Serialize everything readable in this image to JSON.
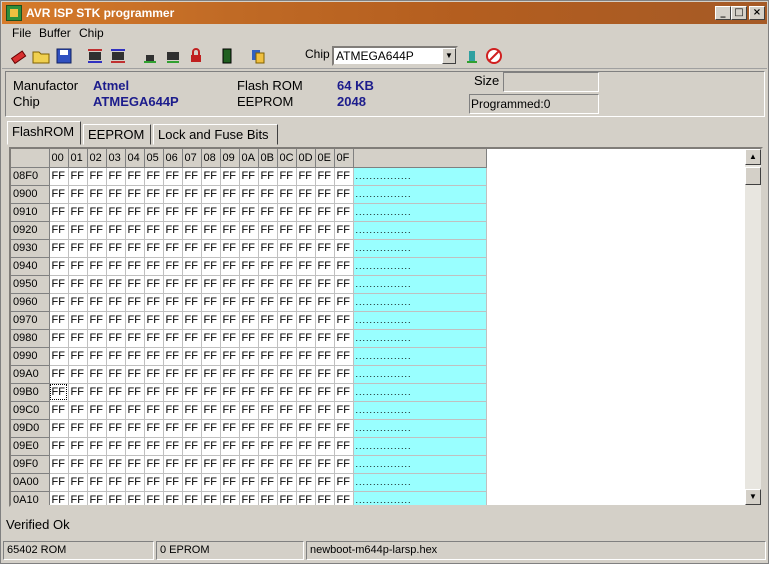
{
  "window": {
    "title": "AVR ISP STK programmer",
    "controls": {
      "minimize": "_",
      "maximize": "□",
      "close": "×"
    }
  },
  "menu": {
    "file": "File",
    "buffer": "Buffer",
    "chip": "Chip"
  },
  "toolbar": {
    "icons": [
      "eraser-icon",
      "open-folder-icon",
      "save-disk-icon",
      "read-chip-icon",
      "write-chip-icon",
      "read-flash-icon",
      "verify-flash-icon",
      "lock-chip-icon",
      "chip-green-icon",
      "copy-icon",
      "auto-program-icon",
      "stop-icon"
    ],
    "chip_label": "Chip",
    "chip_selected": "ATMEGA644P"
  },
  "info": {
    "manufactor_label": "Manufactor",
    "manufactor_value": "Atmel",
    "chip_label": "Chip",
    "chip_value": "ATMEGA644P",
    "flash_label": "Flash ROM",
    "flash_value": "64 KB",
    "eeprom_label": "EEPROM",
    "eeprom_value": "2048",
    "size_label": "Size",
    "size_value": "",
    "programmed": "Programmed:0"
  },
  "tabs": [
    "FlashROM",
    "EEPROM",
    "Lock and Fuse Bits"
  ],
  "grid": {
    "columns": [
      "00",
      "01",
      "02",
      "03",
      "04",
      "05",
      "06",
      "07",
      "08",
      "09",
      "0A",
      "0B",
      "0C",
      "0D",
      "0E",
      "0F"
    ],
    "rows": [
      "08F0",
      "0900",
      "0910",
      "0920",
      "0930",
      "0940",
      "0950",
      "0960",
      "0970",
      "0980",
      "0990",
      "09A0",
      "09B0",
      "09C0",
      "09D0",
      "09E0",
      "09F0",
      "0A00",
      "0A10"
    ],
    "byte_value": "FF",
    "ascii_value": "................",
    "ascii_color": "#99ffff"
  },
  "status": {
    "message": "Verified Ok",
    "rom": "65402 ROM",
    "eprom": "0 EPROM",
    "file": "newboot-m644p-larsp.hex"
  }
}
